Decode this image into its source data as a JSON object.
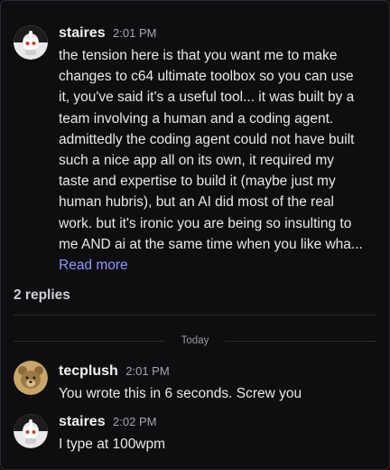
{
  "messages": [
    {
      "username": "staires",
      "time": "2:01 PM",
      "lines": [
        "the tension here is that you want me to make",
        "changes to c64 ultimate toolbox so you can use",
        "it, you've said it's a useful tool... it was built by a",
        "team involving a human and a coding agent.",
        "admittedly the coding agent could not have built",
        "such a nice app all on its own, it required my",
        "taste and expertise to build it (maybe just my",
        "human hubris), but an AI did most of the real",
        "work. but it's ironic you are being so insulting to",
        "me AND ai at the same time when you like wha..."
      ],
      "read_more": "Read more"
    }
  ],
  "thread": {
    "replies_label": "2 replies",
    "day_label": "Today"
  },
  "replies": [
    {
      "username": "tecplush",
      "time": "2:01 PM",
      "text": "You wrote this in 6 seconds. Screw you"
    },
    {
      "username": "staires",
      "time": "2:02 PM",
      "text": "I type at 100wpm"
    }
  ],
  "icons": {
    "staires_avatar": "robot-avatar-icon",
    "tecplush_avatar": "bear-avatar-icon"
  },
  "colors": {
    "background": "#0e0e10",
    "link": "#8f97ff",
    "muted": "#a7a7ad"
  }
}
